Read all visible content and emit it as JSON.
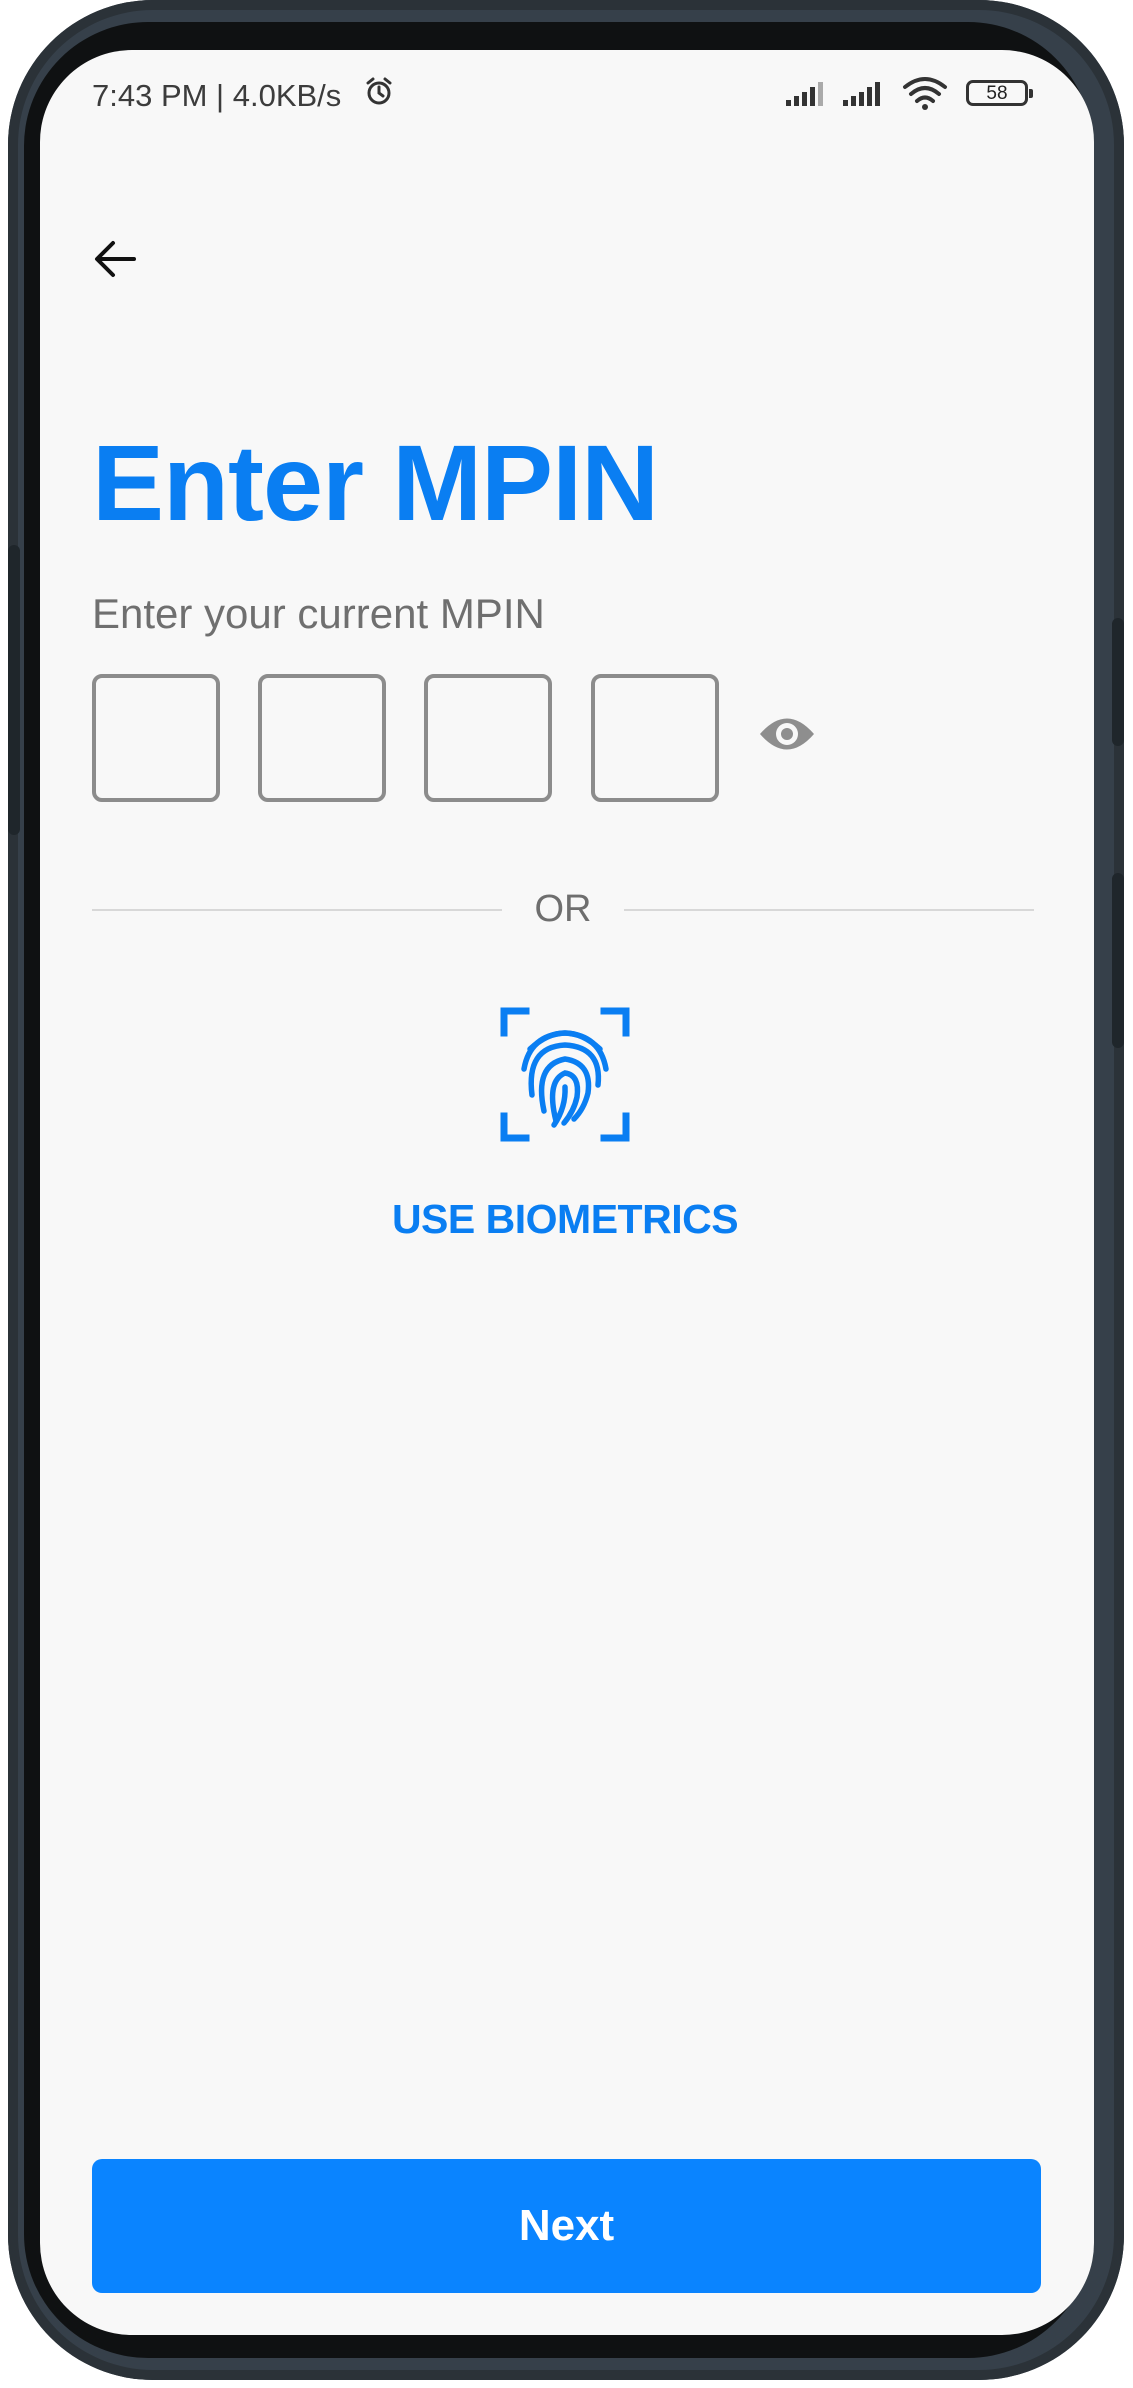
{
  "status_bar": {
    "time_speed": "7:43 PM | 4.0KB/s",
    "battery_level": "58",
    "icons": [
      "alarm-icon",
      "signal-icon",
      "signal-icon",
      "wifi-icon",
      "battery-icon"
    ]
  },
  "header": {
    "back_icon": "arrow-left-icon"
  },
  "main": {
    "title": "Enter MPIN",
    "subtitle": "Enter your current MPIN",
    "pin_digits": [
      "",
      "",
      "",
      ""
    ],
    "toggle_icon": "eye-icon",
    "separator_text": "OR",
    "biometric_icon": "fingerprint-icon",
    "biometric_label": "USE BIOMETRICS"
  },
  "footer": {
    "next_label": "Next"
  },
  "colors": {
    "accent": "#0a7ef2",
    "button": "#0a84ff",
    "background": "#f8f8f8",
    "frame": "#36404a"
  }
}
